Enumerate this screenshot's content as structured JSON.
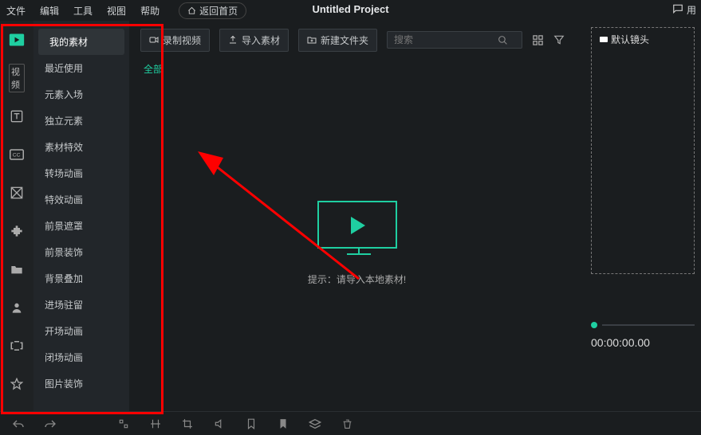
{
  "menubar": {
    "items": [
      "文件",
      "编辑",
      "工具",
      "视图",
      "帮助"
    ],
    "home_label": "返回首页",
    "title": "Untitled Project",
    "right_icon_label": "用"
  },
  "left_rail": {
    "video_badge": "视频"
  },
  "categories": [
    "我的素材",
    "最近使用",
    "元素入场",
    "独立元素",
    "素材特效",
    "转场动画",
    "特效动画",
    "前景遮罩",
    "前景装饰",
    "背景叠加",
    "进场驻留",
    "开场动画",
    "闭场动画",
    "图片装饰"
  ],
  "toolbar": {
    "record_label": "录制视频",
    "import_label": "导入素材",
    "newfolder_label": "新建文件夹",
    "search_placeholder": "搜索"
  },
  "tab_all": "全部",
  "empty_hint": "提示：请导入本地素材!",
  "preview": {
    "camera_label": "默认镜头",
    "timecode": "00:00:00.00"
  }
}
